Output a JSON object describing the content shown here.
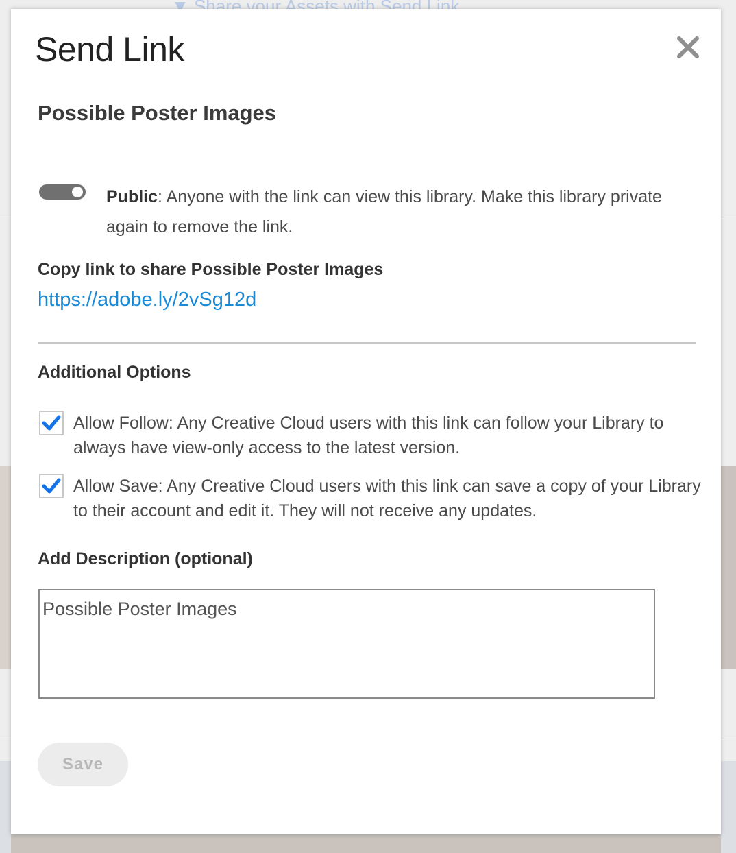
{
  "background": {
    "banner_text": "▼ Share your Assets with Send Link"
  },
  "dialog": {
    "title": "Send Link",
    "close_icon": "close-icon",
    "library_name": "Possible Poster Images",
    "public_toggle": {
      "state": "on",
      "label_bold": "Public",
      "label_rest": ": Anyone with the link can view this library. Make this library private again to remove the link."
    },
    "copy_link": {
      "label": "Copy link to share Possible Poster Images",
      "url": "https://adobe.ly/2vSg12d"
    },
    "additional_options": {
      "heading": "Additional Options",
      "options": [
        {
          "checked": true,
          "text": "Allow Follow: Any Creative Cloud users with this link can follow your Library to always have view-only access to the latest version."
        },
        {
          "checked": true,
          "text": "Allow Save: Any Creative Cloud users with this link can save a copy of your Library to their account and edit it. They will not receive any updates."
        }
      ]
    },
    "description": {
      "label": "Add Description (optional)",
      "value": "Possible Poster Images"
    },
    "save_label": "Save"
  },
  "colors": {
    "link": "#1a8ad6",
    "checkmark": "#1473e6",
    "toggle": "#707070",
    "save_disabled_bg": "#ececec"
  }
}
